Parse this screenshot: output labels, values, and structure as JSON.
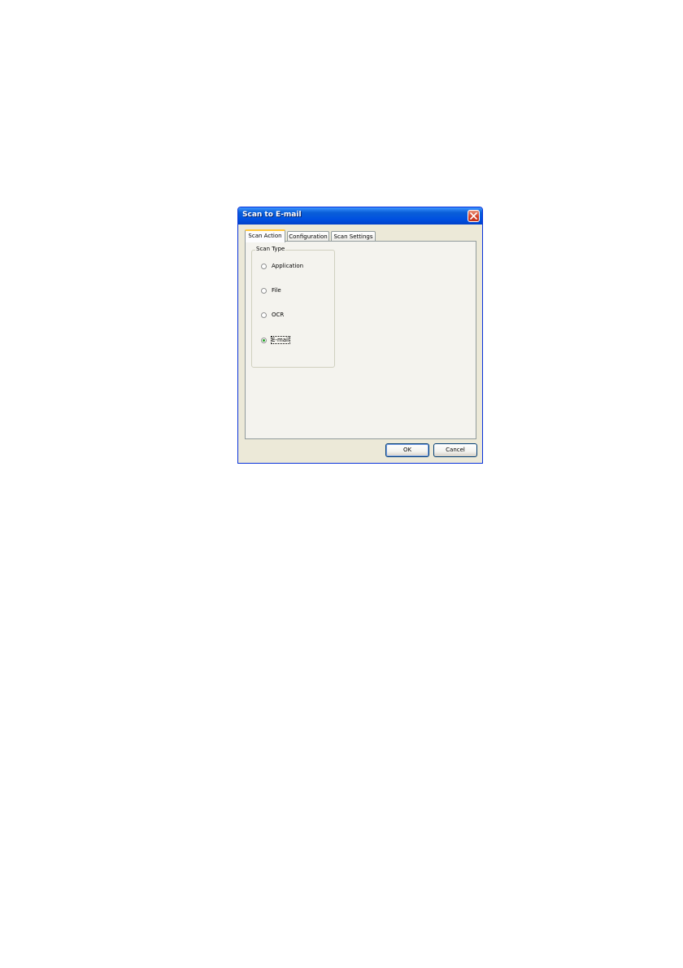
{
  "window": {
    "title": "Scan to E-mail",
    "close_icon": "close-icon"
  },
  "tabs": [
    {
      "label": "Scan Action",
      "selected": true
    },
    {
      "label": "Configuration",
      "selected": false
    },
    {
      "label": "Scan Settings",
      "selected": false
    }
  ],
  "scan_type": {
    "label": "Scan Type",
    "options": [
      {
        "label": "Application",
        "selected": false
      },
      {
        "label": "File",
        "selected": false
      },
      {
        "label": "OCR",
        "selected": false
      },
      {
        "label": "E-mail",
        "selected": true
      }
    ]
  },
  "buttons": {
    "ok": "OK",
    "cancel": "Cancel"
  },
  "colors": {
    "titlebar": "#0a5fd8",
    "dialog_bg": "#ece9d8",
    "close_button": "#d4432a",
    "active_tab_highlight": "#ffc83c",
    "radio_selected": "#21a121"
  }
}
